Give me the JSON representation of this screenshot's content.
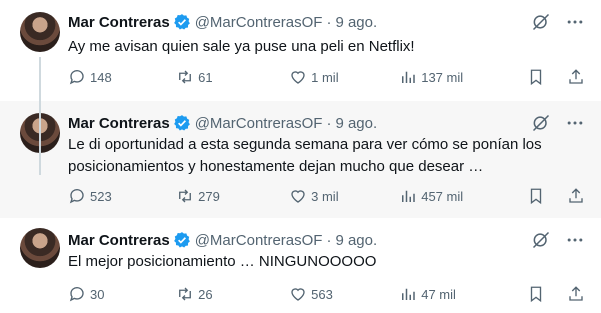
{
  "colors": {
    "accent": "#1d9bf0",
    "muted": "#536471",
    "text": "#0f1419",
    "highlight_bg": "#f7f7f7"
  },
  "tweets": [
    {
      "name": "Mar Contreras",
      "handle": "@MarContrerasOF",
      "separator": "·",
      "date": "9 ago.",
      "text": "Ay me avisan quien sale ya puse una peli en Netflix!",
      "replies": "148",
      "retweets": "61",
      "likes": "1 mil",
      "views": "137 mil"
    },
    {
      "name": "Mar Contreras",
      "handle": "@MarContrerasOF",
      "separator": "·",
      "date": "9 ago.",
      "text": "Le di oportunidad a esta segunda semana para ver cómo se ponían los posicionamientos y honestamente dejan mucho que desear …",
      "replies": "523",
      "retweets": "279",
      "likes": "3 mil",
      "views": "457 mil"
    },
    {
      "name": "Mar Contreras",
      "handle": "@MarContrerasOF",
      "separator": "·",
      "date": "9 ago.",
      "text": "El mejor posicionamiento … NINGUNOOOOO",
      "replies": "30",
      "retweets": "26",
      "likes": "563",
      "views": "47 mil"
    }
  ]
}
